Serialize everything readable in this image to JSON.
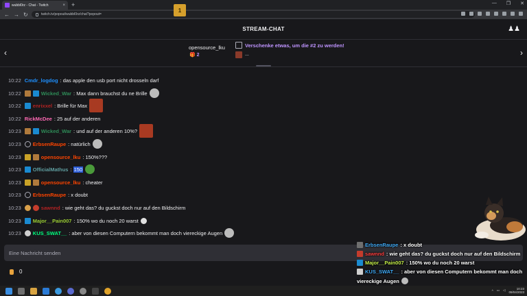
{
  "browser": {
    "tab_title": "wubbl0rz - Chat - Twitch",
    "tab_close": "×",
    "new_tab": "+",
    "url": "twitch.tv/popout/wubbl0rz/chat?popout=",
    "window_controls": [
      "—",
      "❐",
      "✕"
    ],
    "nav": [
      "←",
      "→",
      "↻"
    ]
  },
  "header": {
    "title": "STREAM-CHAT",
    "users_icon": "users-icon"
  },
  "giftbar": {
    "left_arrow": "‹",
    "right_arrow": "›",
    "gift_rank": "1",
    "gifter_name": "opensource_lku",
    "gift_count": "🎁 2",
    "prompt": "Verschenke etwas, um die #2 zu werden!",
    "second": "..."
  },
  "messages": [
    {
      "time": "10:22",
      "user": "Cmdr_logdog",
      "color": "#1e90ff",
      "text": ": das apple den usb port nicht drosseln darf",
      "badges": []
    },
    {
      "time": "10:22",
      "user": "Wicked_War",
      "color": "#2e8b57",
      "text": ": Max dann brauchst du ne Brille",
      "badges": [
        "sub",
        "prime"
      ],
      "emote": "face"
    },
    {
      "time": "10:22",
      "user": "enrixxel",
      "color": "#b22222",
      "text": ": Brille für Max",
      "badges": [
        "prime"
      ],
      "emote": "red"
    },
    {
      "time": "10:22",
      "user": "RickMcDee",
      "color": "#ff69b4",
      "text": ": 25 auf der anderen",
      "badges": []
    },
    {
      "time": "10:23",
      "user": "Wicked_War",
      "color": "#2e8b57",
      "text": ": und auf der anderen 10%?",
      "badges": [
        "sub",
        "prime"
      ],
      "emote": "red"
    },
    {
      "time": "10:23",
      "user": "ErbsenRaupe",
      "color": "#ff4500",
      "text": ": natürlich",
      "badges": [
        "no"
      ],
      "emote": "face"
    },
    {
      "time": "10:23",
      "user": "opensource_lku",
      "color": "#ff4500",
      "text": ": 150%???",
      "badges": [
        "gift",
        "sub"
      ]
    },
    {
      "time": "10:23",
      "user": "OfficialMathus",
      "color": "#5f9ea0",
      "text_pre": ": ",
      "text_hl": "150",
      "text": "",
      "badges": [
        "prime"
      ],
      "emote": "frog"
    },
    {
      "time": "10:23",
      "user": "opensource_lku",
      "color": "#ff4500",
      "text": ": cheater",
      "badges": [
        "gift",
        "sub"
      ]
    },
    {
      "time": "10:23",
      "user": "ErbsenRaupe",
      "color": "#ff4500",
      "text": ": x doubt",
      "badges": [
        "no"
      ]
    },
    {
      "time": "10:23",
      "user": "sawnnd",
      "color": "#b22222",
      "text": ": wie geht das? du guckst doch nur auf den Bildschirm",
      "badges": [
        "bits",
        "red"
      ]
    },
    {
      "time": "10:23",
      "user": "Major__Pain007",
      "color": "#9acd32",
      "text": ": 150% wo du noch 20 warst",
      "badges": [
        "prime"
      ],
      "emote": "small"
    },
    {
      "time": "10:23",
      "user": "KUS_SWAT__",
      "color": "#00ff7f",
      "text": ": aber von diesen Computern bekommt man doch viereckige Augen",
      "badges": [
        "ghost"
      ],
      "emote": "face"
    }
  ],
  "input": {
    "placeholder": "Eine Nachricht senden"
  },
  "points": {
    "value": "0"
  },
  "overlay": [
    {
      "user": "ErbsenRaupe",
      "color": "#3fa9f5",
      "text": ": x doubt"
    },
    {
      "user": "sawnnd",
      "color": "#ff4040",
      "text": ": wie geht das? du guckst doch nur auf den Bildschirm"
    },
    {
      "user": "Major__Pain007",
      "color": "#c8f24a",
      "text": ": 150% wo du noch 20 warst"
    },
    {
      "user": "KUS_SWAT__",
      "color": "#3fa9f5",
      "text": ": aber von diesen Computern bekommt man doch",
      "cont": "viereckige Augen"
    }
  ],
  "taskbar": {
    "time": "10:23",
    "date": "09/04/2023"
  },
  "colors": {
    "bg": "#18181b",
    "accent": "#bf94ff",
    "timestamp": "#adadb8"
  }
}
